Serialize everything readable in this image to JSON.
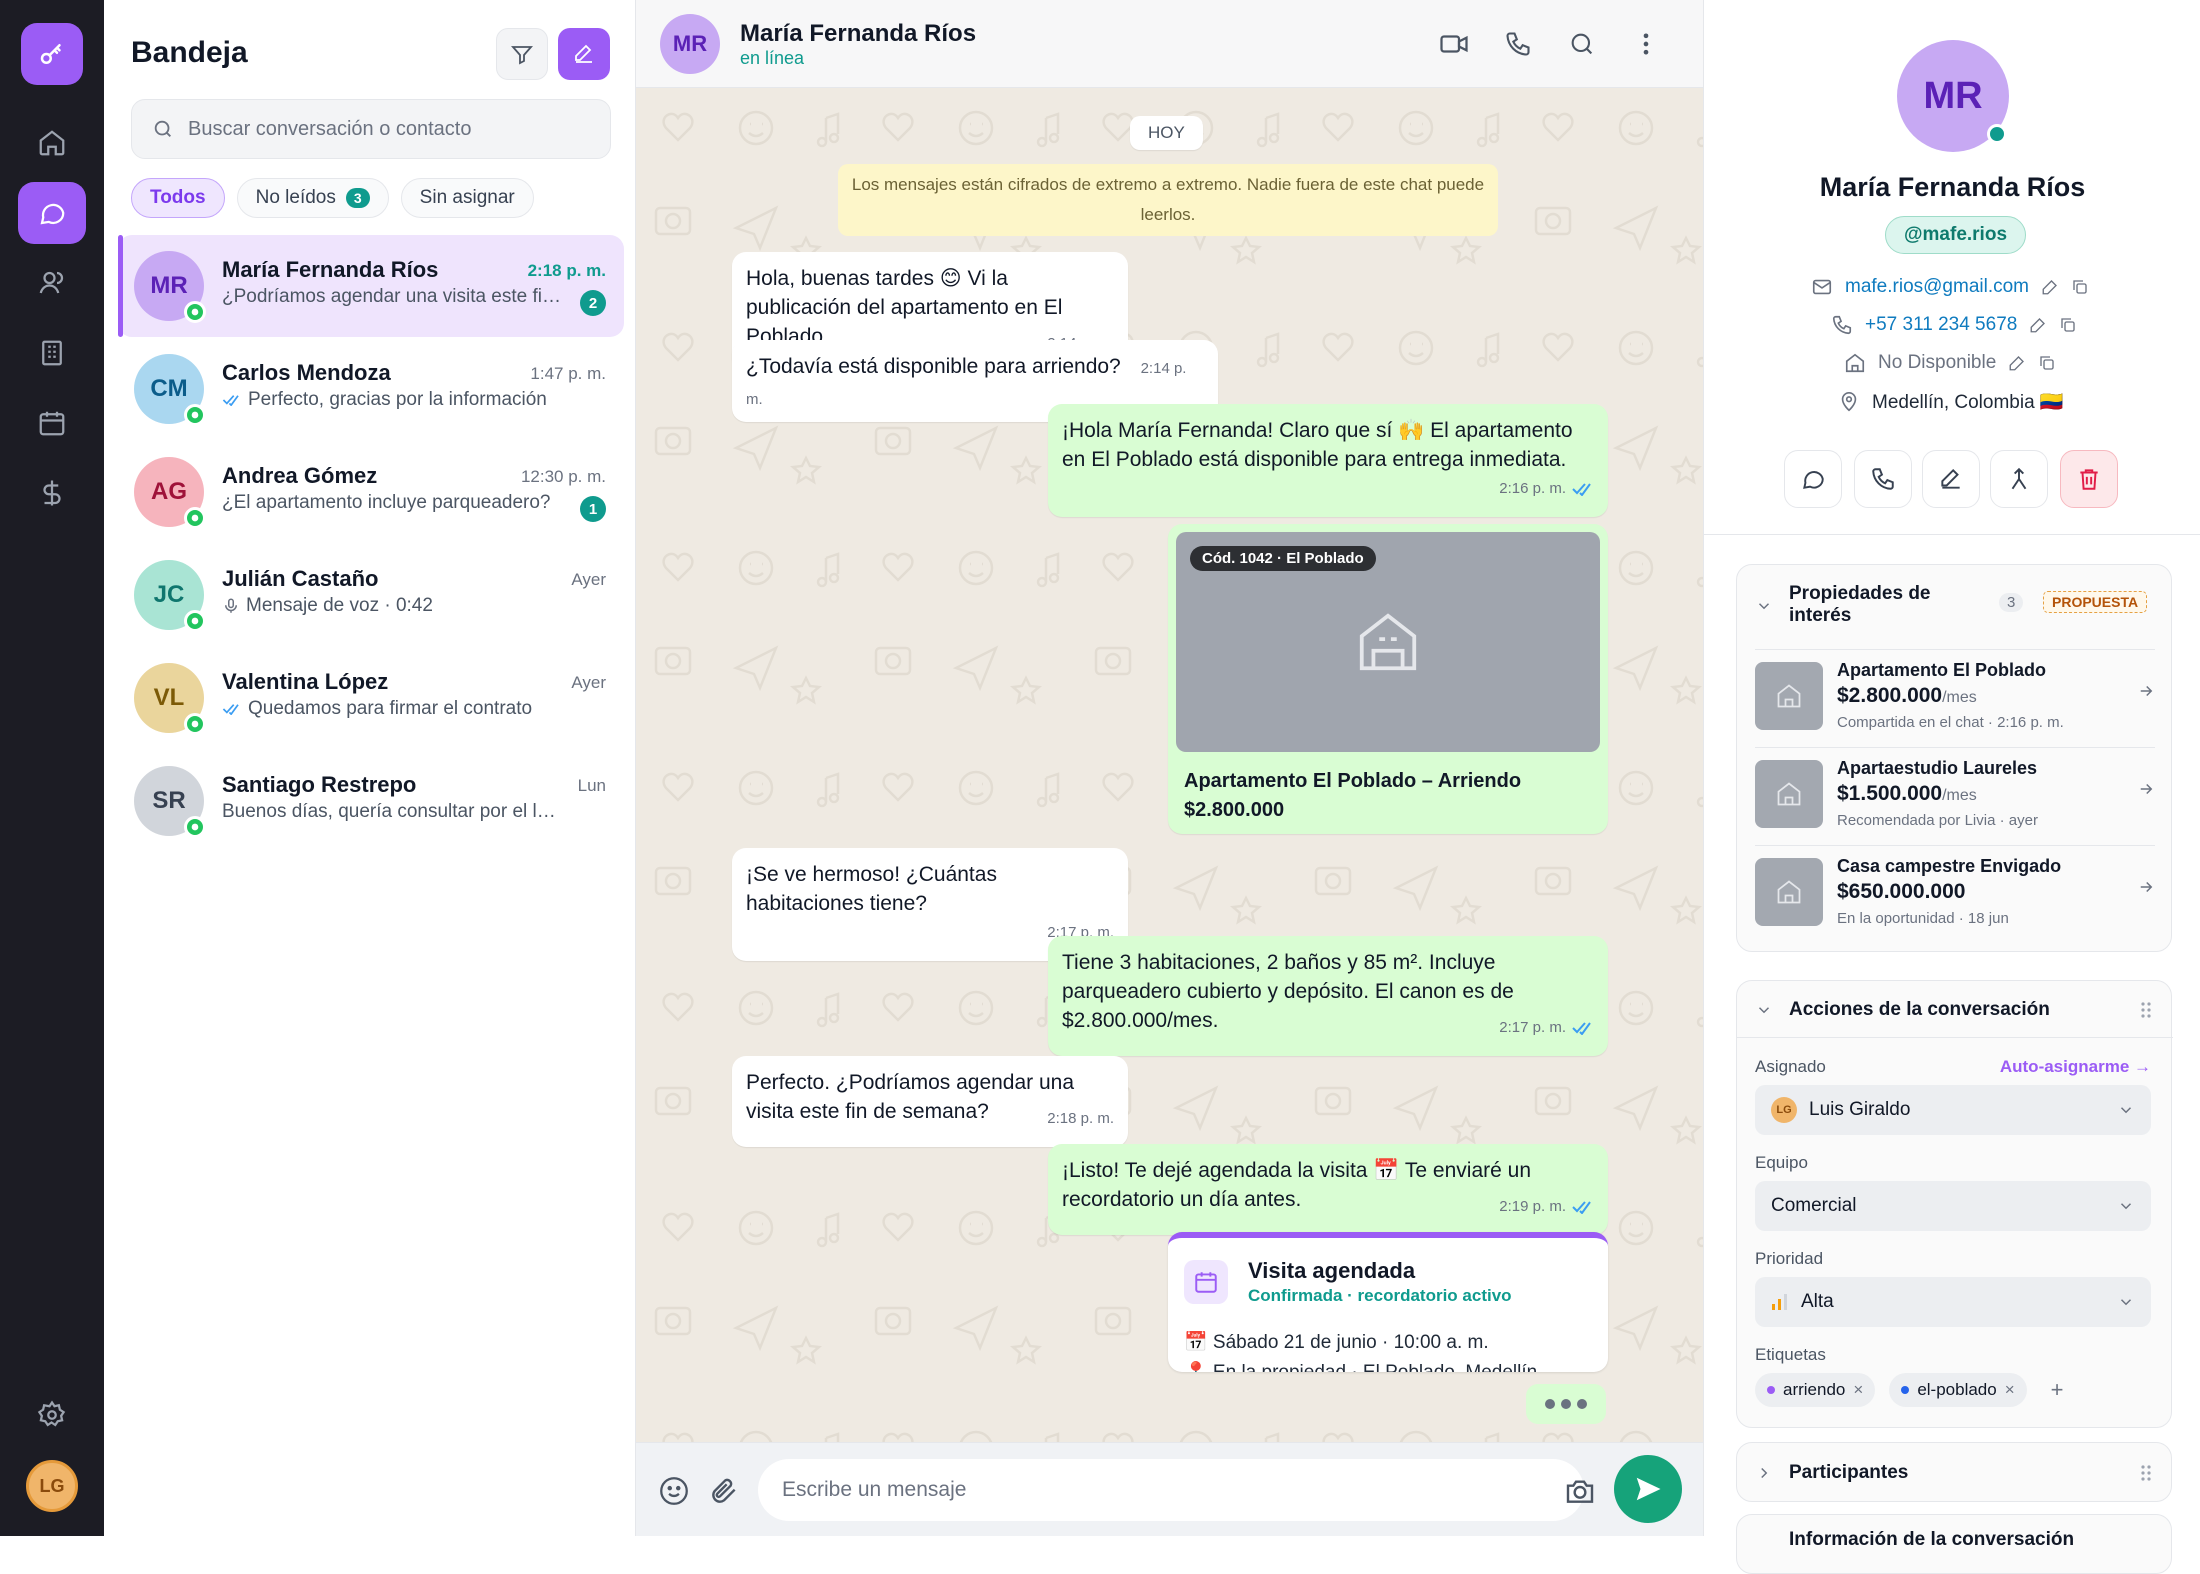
{
  "colors": {
    "accent": "#9b5cf5",
    "teal": "#0f9b8e",
    "bubble_out": "#d9fdd3",
    "chat_bg": "#efeae2"
  },
  "rail": {
    "avatar": "LG",
    "icons": [
      "key-icon",
      "home-icon",
      "chat-icon",
      "users-icon",
      "building-icon",
      "calendar-icon",
      "dollar-icon",
      "settings-icon"
    ]
  },
  "inbox": {
    "title": "Bandeja",
    "search_placeholder": "Buscar conversación o contacto",
    "chips": [
      {
        "label": "Todos"
      },
      {
        "label": "No leídos",
        "count": "3"
      },
      {
        "label": "Sin asignar"
      }
    ],
    "conversations": [
      {
        "initials": "MR",
        "name": "María Fernanda Ríos",
        "time": "2:18 p. m.",
        "preview": "¿Podríamos agendar una visita este fin de semana?",
        "badge": "2",
        "av_bg": "#c7a9f3",
        "av_fg": "#5b21b6"
      },
      {
        "initials": "CM",
        "name": "Carlos Mendoza",
        "time": "1:47 p. m.",
        "preview": "Perfecto, gracias por la información",
        "av_bg": "#aad7f0",
        "av_fg": "#0b5c8a",
        "ticks": true
      },
      {
        "initials": "AG",
        "name": "Andrea Gómez",
        "time": "12:30 p. m.",
        "preview": "¿El apartamento incluye parqueadero?",
        "badge": "1",
        "av_bg": "#f6b4bd",
        "av_fg": "#9f1239"
      },
      {
        "initials": "JC",
        "name": "Julián Castaño",
        "time": "Ayer",
        "preview": "Mensaje de voz · 0:42",
        "av_bg": "#a9e4d4",
        "av_fg": "#0f766e",
        "mic": true
      },
      {
        "initials": "VL",
        "name": "Valentina López",
        "time": "Ayer",
        "preview": "Quedamos para firmar el contrato",
        "av_bg": "#ead59c",
        "av_fg": "#7c5a07",
        "ticks": true
      },
      {
        "initials": "SR",
        "name": "Santiago Restrepo",
        "time": "Lun",
        "preview": "Buenos días, quería consultar por el local",
        "av_bg": "#d1d5db",
        "av_fg": "#374151"
      }
    ]
  },
  "chat": {
    "initials": "MR",
    "name": "María Fernanda Ríos",
    "status": "en línea",
    "day": "HOY",
    "system": "Los mensajes están cifrados de extremo a extremo. Nadie fuera de este chat puede leerlos.",
    "messages": [
      {
        "text": "Hola, buenas tardes 😊 Vi la publicación del apartamento en El Poblado.",
        "time": "2:14 p. m."
      },
      {
        "text": "¿Todavía está disponible para arriendo?",
        "time": "2:14 p. m."
      },
      {
        "text": "¡Hola María Fernanda! Claro que sí 🙌 El apartamento en El Poblado está disponible para entrega inmediata.",
        "time": "2:16 p. m."
      },
      {
        "text": "¡Se ve hermoso! ¿Cuántas habitaciones tiene?",
        "time": "2:17 p. m."
      },
      {
        "text": "Tiene 3 habitaciones, 2 baños y 85 m². Incluye parqueadero cubierto y depósito. El canon es de $2.800.000/mes.",
        "time": "2:17 p. m."
      },
      {
        "text": "Perfecto. ¿Podríamos agendar una visita este fin de semana?",
        "time": "2:18 p. m."
      },
      {
        "text": "¡Listo! Te dejé agendada la visita 📅 Te enviaré un recordatorio un día antes.",
        "time": "2:19 p. m."
      }
    ],
    "property": {
      "code": "Cód. 1042 · El Poblado",
      "title": "Apartamento El Poblado – Arriendo",
      "price": "$2.800.000"
    },
    "visit": {
      "title": "Visita agendada",
      "subtitle": "Confirmada · recordatorio activo",
      "date": "📅 Sábado 21 de junio · 10:00 a. m.",
      "location": "📍 En la propiedad · El Poblado, Medellín"
    },
    "input_placeholder": "Escribe un mensaje"
  },
  "details": {
    "initials": "MR",
    "name": "María Fernanda Ríos",
    "handle": "@mafe.rios",
    "email": "mafe.rios@gmail.com",
    "phone": "+57 311 234 5678",
    "availability": "No Disponible",
    "location": "Medellín, Colombia 🇨🇴",
    "props_panel": {
      "title_line1": "Propiedades de",
      "title_line2": "interés",
      "count": "3",
      "badge": "PROPUESTA",
      "items": [
        {
          "title": "Apartamento El Poblado",
          "price": "$2.800.000",
          "unit": "/mes",
          "note": "Compartida en el chat · 2:16 p. m."
        },
        {
          "title": "Apartaestudio Laureles",
          "price": "$1.500.000",
          "unit": "/mes",
          "note": "Recomendada por Livia · ayer"
        },
        {
          "title": "Casa campestre Envigado",
          "price": "$650.000.000",
          "unit": "",
          "note": "En la oportunidad · 18 jun"
        }
      ]
    },
    "actions_panel": {
      "title": "Acciones de la conversación",
      "assigned_label": "Asignado",
      "auto_assign": "Auto-asignarme →",
      "assignee_initials": "LG",
      "assignee": "Luis Giraldo",
      "team_label": "Equipo",
      "team": "Comercial",
      "priority_label": "Prioridad",
      "priority": "Alta",
      "tags_label": "Etiquetas",
      "tags": [
        {
          "label": "arriendo",
          "color": "#9b5cf5"
        },
        {
          "label": "el-poblado",
          "color": "#2563eb"
        }
      ]
    },
    "participants_title": "Participantes",
    "info_title": "Información de la conversación"
  }
}
